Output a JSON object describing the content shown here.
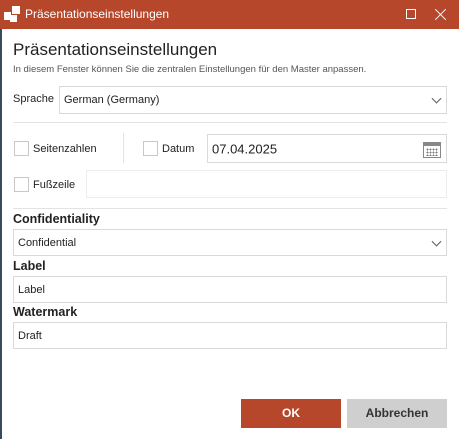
{
  "window": {
    "title": "Präsentationseinstellungen",
    "accent_color": "#b7472a",
    "icons": [
      "app-logo-icon",
      "maximize-icon",
      "close-icon"
    ]
  },
  "header": {
    "heading": "Präsentationseinstellungen",
    "subtitle": "In diesem Fenster können Sie die zentralen Einstellungen für den Master anpassen."
  },
  "language": {
    "label": "Sprache",
    "value": "German (Germany)"
  },
  "page_numbers": {
    "label": "Seitenzahlen",
    "checked": false
  },
  "date": {
    "label": "Datum",
    "checked": false,
    "value": "07.04.2025"
  },
  "footer": {
    "label": "Fußzeile",
    "checked": false,
    "value": ""
  },
  "confidentiality": {
    "label": "Confidentiality",
    "value": "Confidential"
  },
  "label_field": {
    "label": "Label",
    "value": "Label"
  },
  "watermark": {
    "label": "Watermark",
    "value": "Draft"
  },
  "buttons": {
    "ok": "OK",
    "cancel": "Abbrechen"
  }
}
